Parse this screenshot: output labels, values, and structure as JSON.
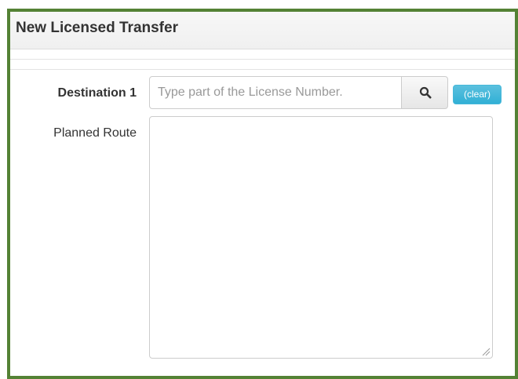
{
  "modal": {
    "title": "New Licensed Transfer"
  },
  "form": {
    "destination": {
      "label": "Destination 1",
      "placeholder": "Type part of the License Number.",
      "value": "",
      "search_icon": "search-icon",
      "clear_label": "(clear)"
    },
    "planned_route": {
      "label": "Planned Route",
      "value": ""
    }
  },
  "colors": {
    "frame_border": "#548235",
    "clear_button": "#5bc0de",
    "header_background": "#f5f5f5"
  }
}
